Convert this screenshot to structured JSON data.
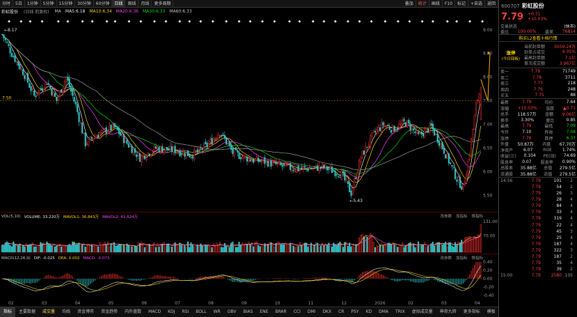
{
  "toolbar": {
    "periods": [
      "分时",
      "5日",
      "1分钟",
      "5分钟",
      "15分钟",
      "30分钟",
      "60分钟",
      "日线",
      "周线",
      "月线",
      "更多周期"
    ],
    "active": "日线",
    "right": [
      "叠加",
      "统计",
      "画线",
      "F10",
      "标记",
      "+自选",
      "返回"
    ]
  },
  "title": {
    "stock_name": "彩虹股份",
    "mode": "(日线 前复权)",
    "ma_items": [
      {
        "label": "MA",
        "value": "",
        "color": "#c8c8c8"
      },
      {
        "label": "MA5:",
        "value": "6.18",
        "color": "#e8e8e8"
      },
      {
        "label": "MA10:",
        "value": "6.34",
        "color": "#ffd400"
      },
      {
        "label": "MA20:",
        "value": "6.36",
        "color": "#ff40ff"
      },
      {
        "label": "MA30:",
        "value": "6.33",
        "color": "#00e000"
      },
      {
        "label": "MA60:",
        "value": "6.33",
        "color": "#c8c8c8"
      }
    ]
  },
  "chart_data": {
    "main": {
      "type": "candlestick",
      "price_axis": [
        "9.00",
        "8.50",
        "8.00",
        "7.50",
        "7.00",
        "6.50",
        "6.00",
        "5.50"
      ],
      "ylim": [
        5.3,
        9.1
      ],
      "reference_price": "7.50",
      "high_label": "8.17",
      "low_label": "5.43",
      "arrow_target": "8.50"
    },
    "volume": {
      "type": "bar",
      "header": [
        "VOL(5,10)",
        "VOLUME: 33.220万",
        "MAVOL1: 36.843万",
        "MAVOL2: 41.624万"
      ],
      "axis": [
        "131.00",
        "70.00"
      ],
      "buttons": [
        "改参数",
        "加指标",
        "换指标"
      ]
    },
    "macd": {
      "type": "bar",
      "header": [
        "MACD(12,26,9)",
        "DIF: -0.025",
        "DEA: 0.002",
        "MACD: -0.073"
      ],
      "axis": [
        "0.40",
        "0.20",
        "0.00",
        "-0.20",
        "-0.40"
      ],
      "buttons": [
        "改参数",
        "加指标",
        "换指标"
      ]
    },
    "x_labels": [
      "02",
      "03",
      "04",
      "05",
      "06",
      "07",
      "08",
      "09",
      "10",
      "11",
      "12",
      "2026",
      "02",
      "03",
      "04"
    ]
  },
  "tabs": [
    "指标",
    "主要数据",
    "成交量",
    "均线",
    "资金博弈",
    "资金趋势",
    "内外盘数",
    "MACD",
    "KDJ",
    "RSI",
    "BOLL",
    "WR",
    "OBV",
    "BIAS",
    "ENE",
    "BRAR",
    "CCI",
    "DMI",
    "DKX",
    "CR",
    "PSY",
    "KD",
    "DMA",
    "TRIX",
    "虚拟成交量",
    "神奇九转",
    "更多指标",
    "模板"
  ],
  "active_tab": "指标",
  "side": {
    "code": "600707",
    "name": "彩虹股份",
    "price": "7.79",
    "change": "+0.71",
    "change_pct": "+10.03%",
    "status_label": "交易状态",
    "status_value": "(休市)",
    "weibi_label": "委比",
    "weibi_value": "100.00%",
    "weicha_label": "委差",
    "weicha_value": "76814",
    "l2_label": "购买L2查看十档行情",
    "limit_title": "涨停",
    "limit_sub": "(今日回板)",
    "limit_items": [
      {
        "k": "当前封单额",
        "v": "5559.24万"
      },
      {
        "k": "封单占成交",
        "v": "6.05%"
      },
      {
        "k": "最高封单额",
        "v": "7.1亿"
      },
      {
        "k": "首次成交额",
        "v": "3.967亿"
      }
    ],
    "sells": [
      {
        "k": "卖一",
        "p": "7.79",
        "v": "71749"
      },
      {
        "k": "卖二",
        "p": "7.78",
        "v": "3711"
      },
      {
        "k": "卖三",
        "p": "7.77",
        "v": "218"
      },
      {
        "k": "卖四",
        "p": "7.76",
        "v": "248"
      },
      {
        "k": "买五",
        "p": "7.75",
        "v": "88"
      }
    ],
    "stats": [
      {
        "k1": "最新",
        "v1": "7.79",
        "k2": "均价",
        "v2": "7.64"
      },
      {
        "k1": "涨幅",
        "v1": "+10.03%",
        "k2": "涨跌",
        "v2": "▲0.71"
      },
      {
        "k1": "总手",
        "v1": "118.57万",
        "k2": "金额",
        "v2": "9.06亿"
      },
      {
        "k1": "换手",
        "v1": "3.30%",
        "k2": "量比",
        "v2": "0.85"
      },
      {
        "k1": "最高",
        "v1": "7.79",
        "k2": "最低",
        "v2": "7.09"
      },
      {
        "k1": "今开",
        "v1": "7.10",
        "k2": "昨收",
        "v2": "7.08"
      },
      {
        "k1": "涨停",
        "v1": "7.79",
        "k2": "跌停",
        "v2": "6.37"
      },
      {
        "k1": "外盘",
        "v1": "50.87万",
        "k2": "内盘",
        "v2": "67.70万"
      },
      {
        "k1": "净资产",
        "v1": "6.07",
        "k2": "ROE",
        "v2": "1.74%"
      },
      {
        "k1": "收益(三)",
        "v1": "0.104",
        "k2": "PE(动)",
        "v2": "74.69"
      },
      {
        "k1": "股息率",
        "v1": "0.07",
        "k2": "股息率",
        "v2": "0.90%"
      },
      {
        "k1": "总股本",
        "v1": "35.88亿",
        "k2": "总值",
        "v2": "279.5亿"
      },
      {
        "k1": "流通股",
        "v1": "35.88亿",
        "k2": "流值",
        "v2": "279.5亿"
      }
    ],
    "trades": [
      {
        "t": "14:56",
        "p": "7.79",
        "v": "101",
        "f": "2"
      },
      {
        "t": "",
        ":": "",
        "p": "7.79",
        "v": "54",
        "f": "2"
      },
      {
        "t": "",
        "p": "7.79",
        "v": "26",
        "f": "3"
      },
      {
        "t": "",
        "p": "7.79",
        "v": "28",
        "f": "4"
      },
      {
        "t": "",
        "p": "7.79",
        "v": "84",
        "f": "4"
      },
      {
        "t": "",
        "p": "7.79",
        "v": "33",
        "f": "4"
      },
      {
        "t": "",
        "p": "7.79",
        "v": "319",
        "f": "4"
      },
      {
        "t": "",
        "p": "7.79",
        "v": "22",
        "f": "4"
      },
      {
        "t": "",
        "p": "7.79",
        "v": "45",
        "f": "3"
      },
      {
        "t": "",
        "p": "7.79",
        "v": "25",
        "f": "4"
      },
      {
        "t": "",
        "p": "7.79",
        "v": "187",
        "f": "4"
      },
      {
        "t": "",
        "p": "7.79",
        "v": "322",
        "f": "3"
      },
      {
        "t": "",
        "p": "7.79",
        "v": "187",
        "f": "2"
      },
      {
        "t": "",
        "p": "7.79",
        "v": "35",
        "f": "4"
      },
      {
        "t": "",
        "p": "7.79",
        "v": "39",
        "f": "2"
      },
      {
        "t": "15:00",
        "p": "7.79",
        "v": "2580",
        "f": "105"
      }
    ]
  }
}
